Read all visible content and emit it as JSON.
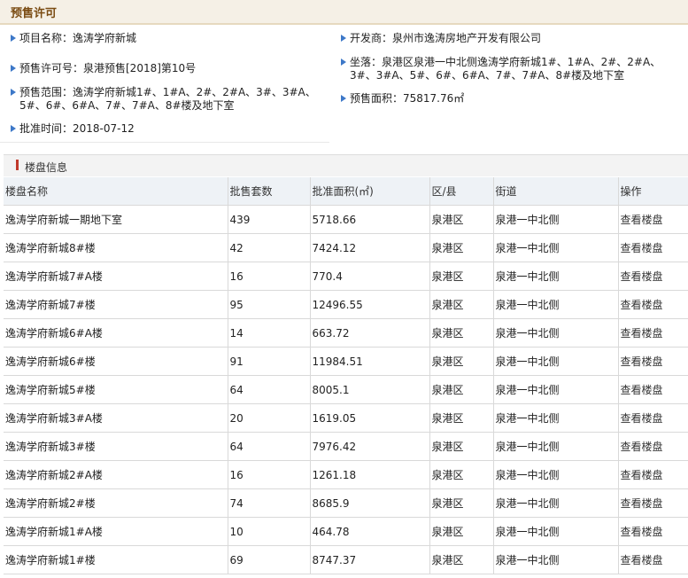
{
  "title": "预售许可",
  "info": {
    "project_name": "项目名称：逸涛学府新城",
    "developer": "开发商：泉州市逸涛房地产开发有限公司",
    "permit_no": "预售许可号：泉港预售[2018]第10号",
    "location": "坐落：泉港区泉港一中北侧逸涛学府新城1#、1#A、2#、2#A、3#、3#A、5#、6#、6#A、7#、7#A、8#楼及地下室",
    "scope": "预售范围：逸涛学府新城1#、1#A、2#、2#A、3#、3#A、5#、6#、6#A、7#、7#A、8#楼及地下室",
    "area": "预售面积：75817.76㎡",
    "approval_date": "批准时间：2018-07-12"
  },
  "section_title": "楼盘信息",
  "table": {
    "headers": [
      "楼盘名称",
      "批售套数",
      "批准面积(㎡)",
      "区/县",
      "街道",
      "操作"
    ],
    "rows": [
      [
        "逸涛学府新城一期地下室",
        "439",
        "5718.66",
        "泉港区",
        "泉港一中北侧",
        "查看楼盘"
      ],
      [
        "逸涛学府新城8#楼",
        "42",
        "7424.12",
        "泉港区",
        "泉港一中北侧",
        "查看楼盘"
      ],
      [
        "逸涛学府新城7#A楼",
        "16",
        "770.4",
        "泉港区",
        "泉港一中北侧",
        "查看楼盘"
      ],
      [
        "逸涛学府新城7#楼",
        "95",
        "12496.55",
        "泉港区",
        "泉港一中北侧",
        "查看楼盘"
      ],
      [
        "逸涛学府新城6#A楼",
        "14",
        "663.72",
        "泉港区",
        "泉港一中北侧",
        "查看楼盘"
      ],
      [
        "逸涛学府新城6#楼",
        "91",
        "11984.51",
        "泉港区",
        "泉港一中北侧",
        "查看楼盘"
      ],
      [
        "逸涛学府新城5#楼",
        "64",
        "8005.1",
        "泉港区",
        "泉港一中北侧",
        "查看楼盘"
      ],
      [
        "逸涛学府新城3#A楼",
        "20",
        "1619.05",
        "泉港区",
        "泉港一中北侧",
        "查看楼盘"
      ],
      [
        "逸涛学府新城3#楼",
        "64",
        "7976.42",
        "泉港区",
        "泉港一中北侧",
        "查看楼盘"
      ],
      [
        "逸涛学府新城2#A楼",
        "16",
        "1261.18",
        "泉港区",
        "泉港一中北侧",
        "查看楼盘"
      ],
      [
        "逸涛学府新城2#楼",
        "74",
        "8685.9",
        "泉港区",
        "泉港一中北侧",
        "查看楼盘"
      ],
      [
        "逸涛学府新城1#A楼",
        "10",
        "464.78",
        "泉港区",
        "泉港一中北侧",
        "查看楼盘"
      ],
      [
        "逸涛学府新城1#楼",
        "69",
        "8747.37",
        "泉港区",
        "泉港一中北侧",
        "查看楼盘"
      ]
    ]
  }
}
